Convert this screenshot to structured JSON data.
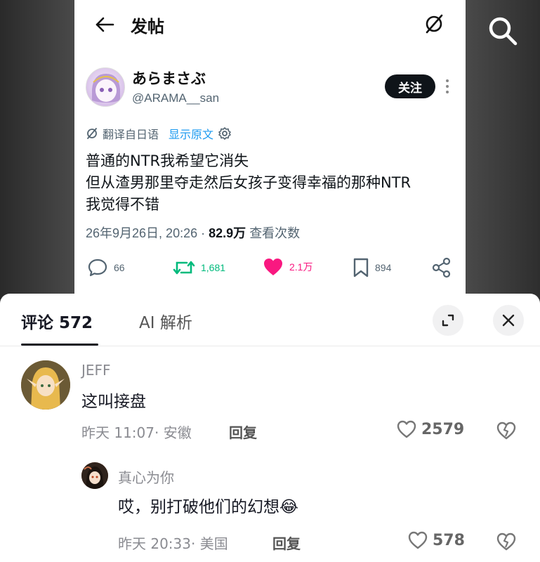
{
  "header": {
    "title": "发帖"
  },
  "tweet": {
    "user_name": "あらまさぶ",
    "user_handle": "@ARAMA__san",
    "follow_label": "关注",
    "translate_label": "翻译自日语",
    "show_original_label": "显示原文",
    "text_lines": [
      "普通的NTR我希望它消失",
      "但从渣男那里夺走然后女孩子变得幸福的那种NTR",
      "我觉得不错"
    ],
    "datetime": "26年9月26日, 20:26",
    "views_count": "82.9万",
    "views_label": "查看次数",
    "actions": {
      "replies": "66",
      "retweets": "1,681",
      "likes": "2.1万",
      "bookmarks": "894"
    }
  },
  "sheet": {
    "tab_comments": "评论 572",
    "tab_ai": "AI 解析"
  },
  "comments": [
    {
      "name": "JEFF",
      "text": "这叫接盘",
      "meta": "昨天 11:07· 安徽",
      "reply_label": "回复",
      "likes": "2579"
    },
    {
      "name": "真心为你",
      "text": "哎，别打破他们的幻想",
      "emoji": "😂",
      "meta": "昨天 20:33· 美国",
      "reply_label": "回复",
      "likes": "578"
    }
  ],
  "colors": {
    "accent_blue": "#1d9bf0",
    "retweet_green": "#00ba7c",
    "like_pink": "#f91880"
  }
}
